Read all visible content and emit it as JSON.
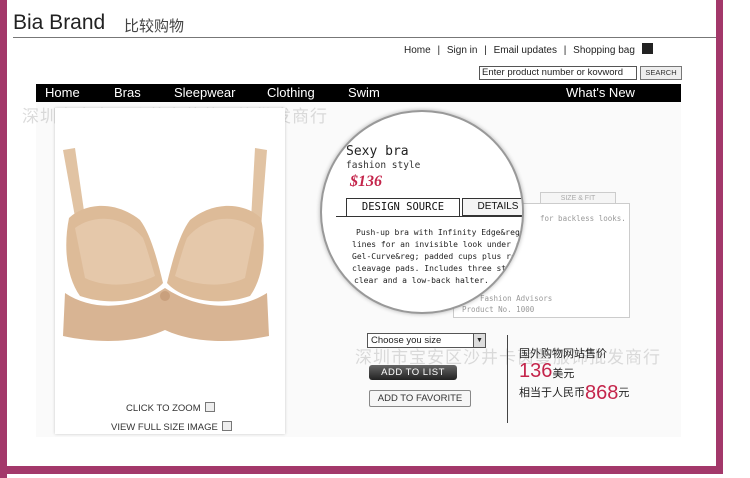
{
  "brand": {
    "name": "Bia Brand",
    "cn_name": "比较购物"
  },
  "top_links": {
    "home": "Home",
    "signin": "Sign in",
    "email": "Email updates",
    "bag": "Shopping bag",
    "sep": "|"
  },
  "search": {
    "value": "Enter product number or kovword",
    "button": "SEARCH"
  },
  "nav": {
    "items": [
      {
        "label": "Home"
      },
      {
        "label": "Bras"
      },
      {
        "label": "Sleepwear"
      },
      {
        "label": "Clothing"
      },
      {
        "label": "Swim"
      },
      {
        "label": "What's New"
      }
    ]
  },
  "watermarks": [
    "深圳市宝安区沙井卡茵蔓服饰批发商行",
    "深圳市宝安区沙井卡茵蔓服饰批发商行"
  ],
  "product": {
    "title": "Sexy bra",
    "subtitle": "fashion style",
    "price": "$136",
    "tabs": [
      "DESIGN SOURCE",
      "DETAILS"
    ],
    "description": [
      "Push-up bra with Infinity Edge&reg; that eliminates",
      "lines for an invisible look under clothes.",
      "Gel-Curve&reg; padded cups plus removable extreme",
      "cleavage pads. Includes three straps: regular,",
      "clear and a low-back halter."
    ],
    "ghost_tab": "SIZE & FIT",
    "ghost_lines": [
      "for backless looks.",
      "Fashion Advisors",
      "Product No. 1000"
    ]
  },
  "image_actions": {
    "zoom": "CLICK TO ZOOM",
    "fullsize": "VIEW FULL SIZE IMAGE"
  },
  "size_select": {
    "value": "Choose you  size"
  },
  "buttons": {
    "add_list": "ADD TO LIST",
    "add_fav": "ADD TO FAVORITE"
  },
  "price_box": {
    "label": "国外购物网站售价",
    "usd_value": "136",
    "usd_unit": "美元",
    "rmb_prefix": "相当于人民币",
    "rmb_value": "868",
    "rmb_unit": "元"
  },
  "colors": {
    "frame": "#a3386a",
    "price": "#c4254b",
    "nav_bg": "#000000"
  }
}
